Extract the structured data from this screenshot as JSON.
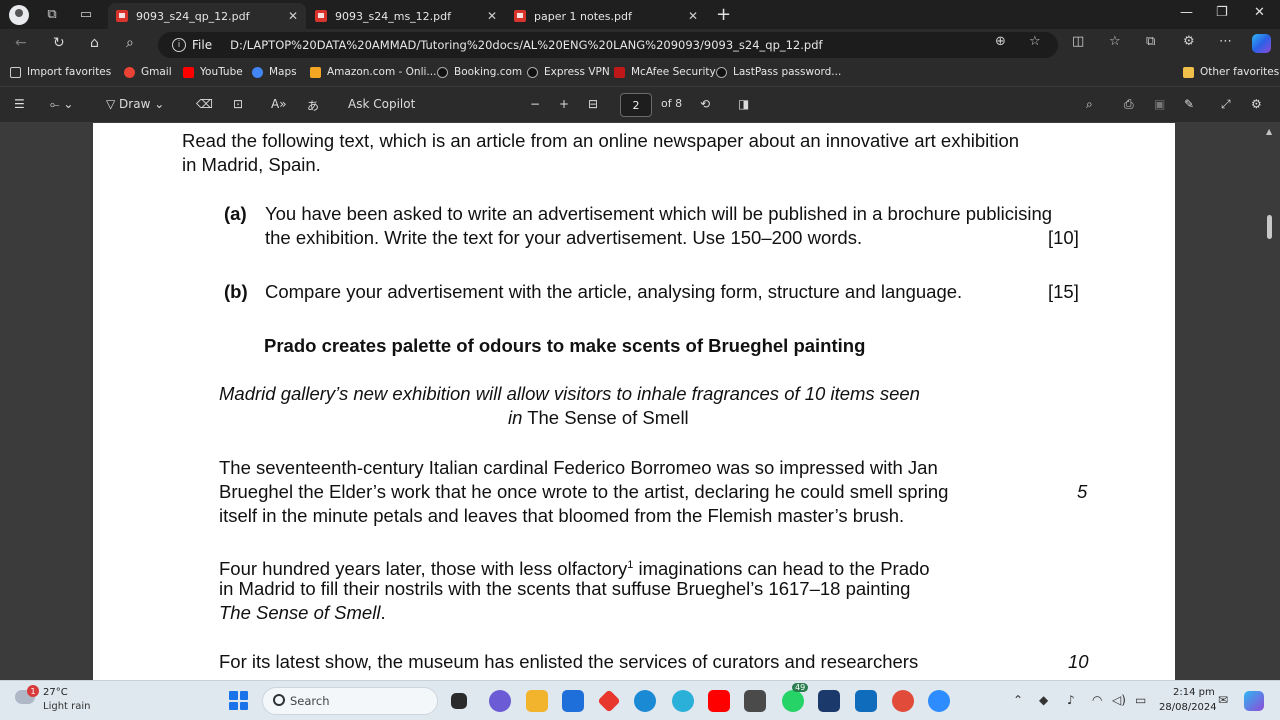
{
  "tabs": [
    {
      "title": "9093_s24_qp_12.pdf",
      "active": true
    },
    {
      "title": "9093_s24_ms_12.pdf",
      "active": false
    },
    {
      "title": "paper 1 notes.pdf",
      "active": false
    }
  ],
  "address": {
    "label": "File",
    "url": "D:/LAPTOP%20DATA%20AMMAD/Tutoring%20docs/AL%20ENG%20LANG%209093/9093_s24_qp_12.pdf"
  },
  "favorites": {
    "items": [
      "Import favorites",
      "Gmail",
      "YouTube",
      "Maps",
      "Amazon.com - Onli...",
      "Booking.com",
      "Express VPN",
      "McAfee Security",
      "LastPass password..."
    ],
    "other": "Other favorites"
  },
  "pdf_toolbar": {
    "draw": "Draw",
    "ask_copilot": "Ask Copilot",
    "page": "2",
    "of_pages": "of 8"
  },
  "document": {
    "intro": [
      "Read the following text, which is an article from an online newspaper about an innovative art exhibition",
      "in Madrid, Spain."
    ],
    "qa_label": "(a)",
    "qa_lines": [
      "You have been asked to write an advertisement which will be published in a brochure publicising",
      "the exhibition. Write the text for your advertisement. Use 150–200 words."
    ],
    "qa_marks": "[10]",
    "qb_label": "(b)",
    "qb_text": "Compare your advertisement with the article, analysing form, structure and language.",
    "qb_marks": "[15]",
    "headline": "Prado creates palette of odours to make scents of Brueghel painting",
    "standfirst_1": "Madrid gallery’s new exhibition will allow visitors to inhale fragrances of 10 items seen",
    "standfirst_in": "in",
    "standfirst_title": "The Sense of Smell",
    "para1": [
      "The seventeenth-century Italian cardinal Federico Borromeo was so impressed with Jan",
      "Brueghel the Elder’s work that he once wrote to the artist, declaring he could smell spring",
      "itself in the minute petals and leaves that bloomed from the Flemish master’s brush."
    ],
    "para2_l1a": "Four hundred years later, those with less olfactory",
    "para2_sup": "1",
    "para2_l1b": " imaginations can head to the Prado",
    "para2_l2": "in Madrid to fill their nostrils with the scents that suffuse Brueghel’s 1617–18 painting",
    "para2_l3": "The Sense of Smell",
    "para2_l3_end": ".",
    "para3": "For its latest show, the museum has enlisted the services of curators and researchers",
    "line_num_5": "5",
    "line_num_10": "10"
  },
  "taskbar": {
    "weather_temp": "27°C",
    "weather_desc": "Light rain",
    "weather_badge": "1",
    "search": "Search",
    "whatsapp_badge": "49",
    "time": "2:14 pm",
    "date": "28/08/2024"
  }
}
